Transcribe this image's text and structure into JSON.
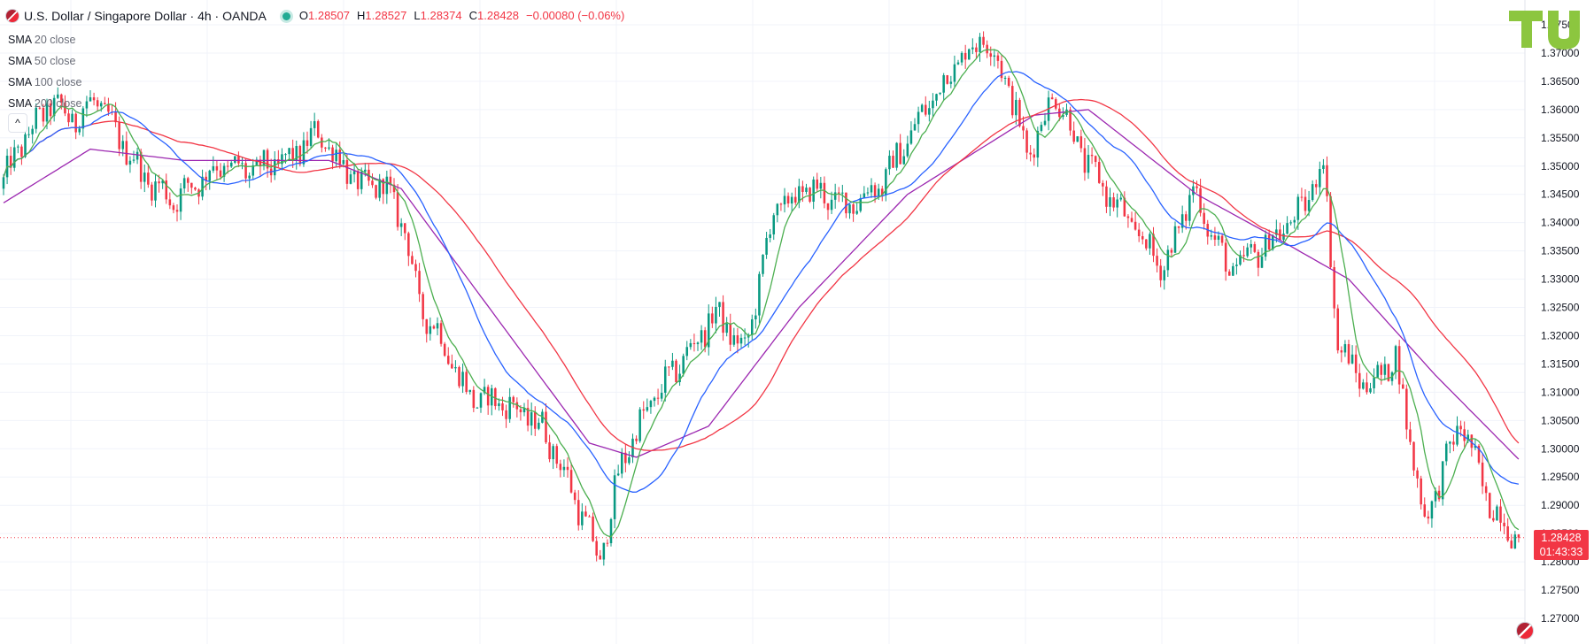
{
  "header": {
    "symbol": "U.S. Dollar / Singapore Dollar · 4h · OANDA",
    "open_label": "O",
    "open": "1.28507",
    "high_label": "H",
    "high": "1.28527",
    "low_label": "L",
    "low": "1.28374",
    "close_label": "C",
    "close": "1.28428",
    "change": "−0.00080 (−0.06%)"
  },
  "studies": [
    {
      "name": "SMA",
      "params": "20 close",
      "color": "#4caf50"
    },
    {
      "name": "SMA",
      "params": "50 close",
      "color": "#2962ff"
    },
    {
      "name": "SMA",
      "params": "100 close",
      "color": "#f23645"
    },
    {
      "name": "SMA",
      "params": "200 close",
      "color": "#9c27b0"
    }
  ],
  "collapse_glyph": "^",
  "last_price": {
    "value": "1.28428",
    "countdown": "01:43:33",
    "color": "#f23645"
  },
  "colors": {
    "up": "#089981",
    "down": "#f23645",
    "grid": "#f0f3fa",
    "axis_text": "#131722"
  },
  "chart_data": {
    "type": "candlestick",
    "title": "U.S. Dollar / Singapore Dollar · 4h · OANDA",
    "y_ticks": [
      "1.37500",
      "1.37000",
      "1.36500",
      "1.36000",
      "1.35500",
      "1.35000",
      "1.34500",
      "1.34000",
      "1.33500",
      "1.33000",
      "1.32500",
      "1.32000",
      "1.31500",
      "1.31000",
      "1.30500",
      "1.30000",
      "1.29500",
      "1.29000",
      "1.28500",
      "1.28000",
      "1.27500",
      "1.27000"
    ],
    "ylim": [
      1.2665,
      1.3765
    ],
    "num_bars": 420,
    "series_anchors": [
      [
        0,
        1.346
      ],
      [
        6,
        1.354
      ],
      [
        14,
        1.361
      ],
      [
        21,
        1.358
      ],
      [
        26,
        1.362
      ],
      [
        40,
        1.348
      ],
      [
        48,
        1.344
      ],
      [
        60,
        1.35
      ],
      [
        70,
        1.349
      ],
      [
        80,
        1.351
      ],
      [
        88,
        1.356
      ],
      [
        100,
        1.346
      ],
      [
        106,
        1.347
      ],
      [
        112,
        1.339
      ],
      [
        116,
        1.325
      ],
      [
        120,
        1.322
      ],
      [
        130,
        1.309
      ],
      [
        140,
        1.308
      ],
      [
        150,
        1.304
      ],
      [
        158,
        1.293
      ],
      [
        166,
        1.28
      ],
      [
        172,
        1.298
      ],
      [
        180,
        1.308
      ],
      [
        198,
        1.324
      ],
      [
        206,
        1.317
      ],
      [
        214,
        1.342
      ],
      [
        224,
        1.346
      ],
      [
        234,
        1.343
      ],
      [
        244,
        1.347
      ],
      [
        254,
        1.358
      ],
      [
        264,
        1.368
      ],
      [
        272,
        1.373
      ],
      [
        278,
        1.366
      ],
      [
        284,
        1.352
      ],
      [
        292,
        1.363
      ],
      [
        300,
        1.351
      ],
      [
        312,
        1.34
      ],
      [
        322,
        1.332
      ],
      [
        330,
        1.346
      ],
      [
        340,
        1.331
      ],
      [
        350,
        1.336
      ],
      [
        360,
        1.342
      ],
      [
        366,
        1.351
      ],
      [
        370,
        1.318
      ],
      [
        378,
        1.311
      ],
      [
        386,
        1.316
      ],
      [
        394,
        1.287
      ],
      [
        404,
        1.305
      ],
      [
        412,
        1.29
      ],
      [
        420,
        1.2843
      ]
    ],
    "sma_periods": [
      20,
      50,
      100,
      200
    ],
    "sma_200_anchors": [
      [
        0,
        1.3435
      ],
      [
        24,
        1.353
      ],
      [
        50,
        1.351
      ],
      [
        90,
        1.351
      ],
      [
        110,
        1.346
      ],
      [
        140,
        1.32
      ],
      [
        162,
        1.301
      ],
      [
        175,
        1.2985
      ],
      [
        195,
        1.304
      ],
      [
        220,
        1.325
      ],
      [
        250,
        1.345
      ],
      [
        285,
        1.359
      ],
      [
        300,
        1.36
      ],
      [
        330,
        1.345
      ],
      [
        350,
        1.338
      ],
      [
        372,
        1.33
      ],
      [
        396,
        1.313
      ],
      [
        420,
        1.2975
      ]
    ],
    "last_close": 1.28428
  }
}
